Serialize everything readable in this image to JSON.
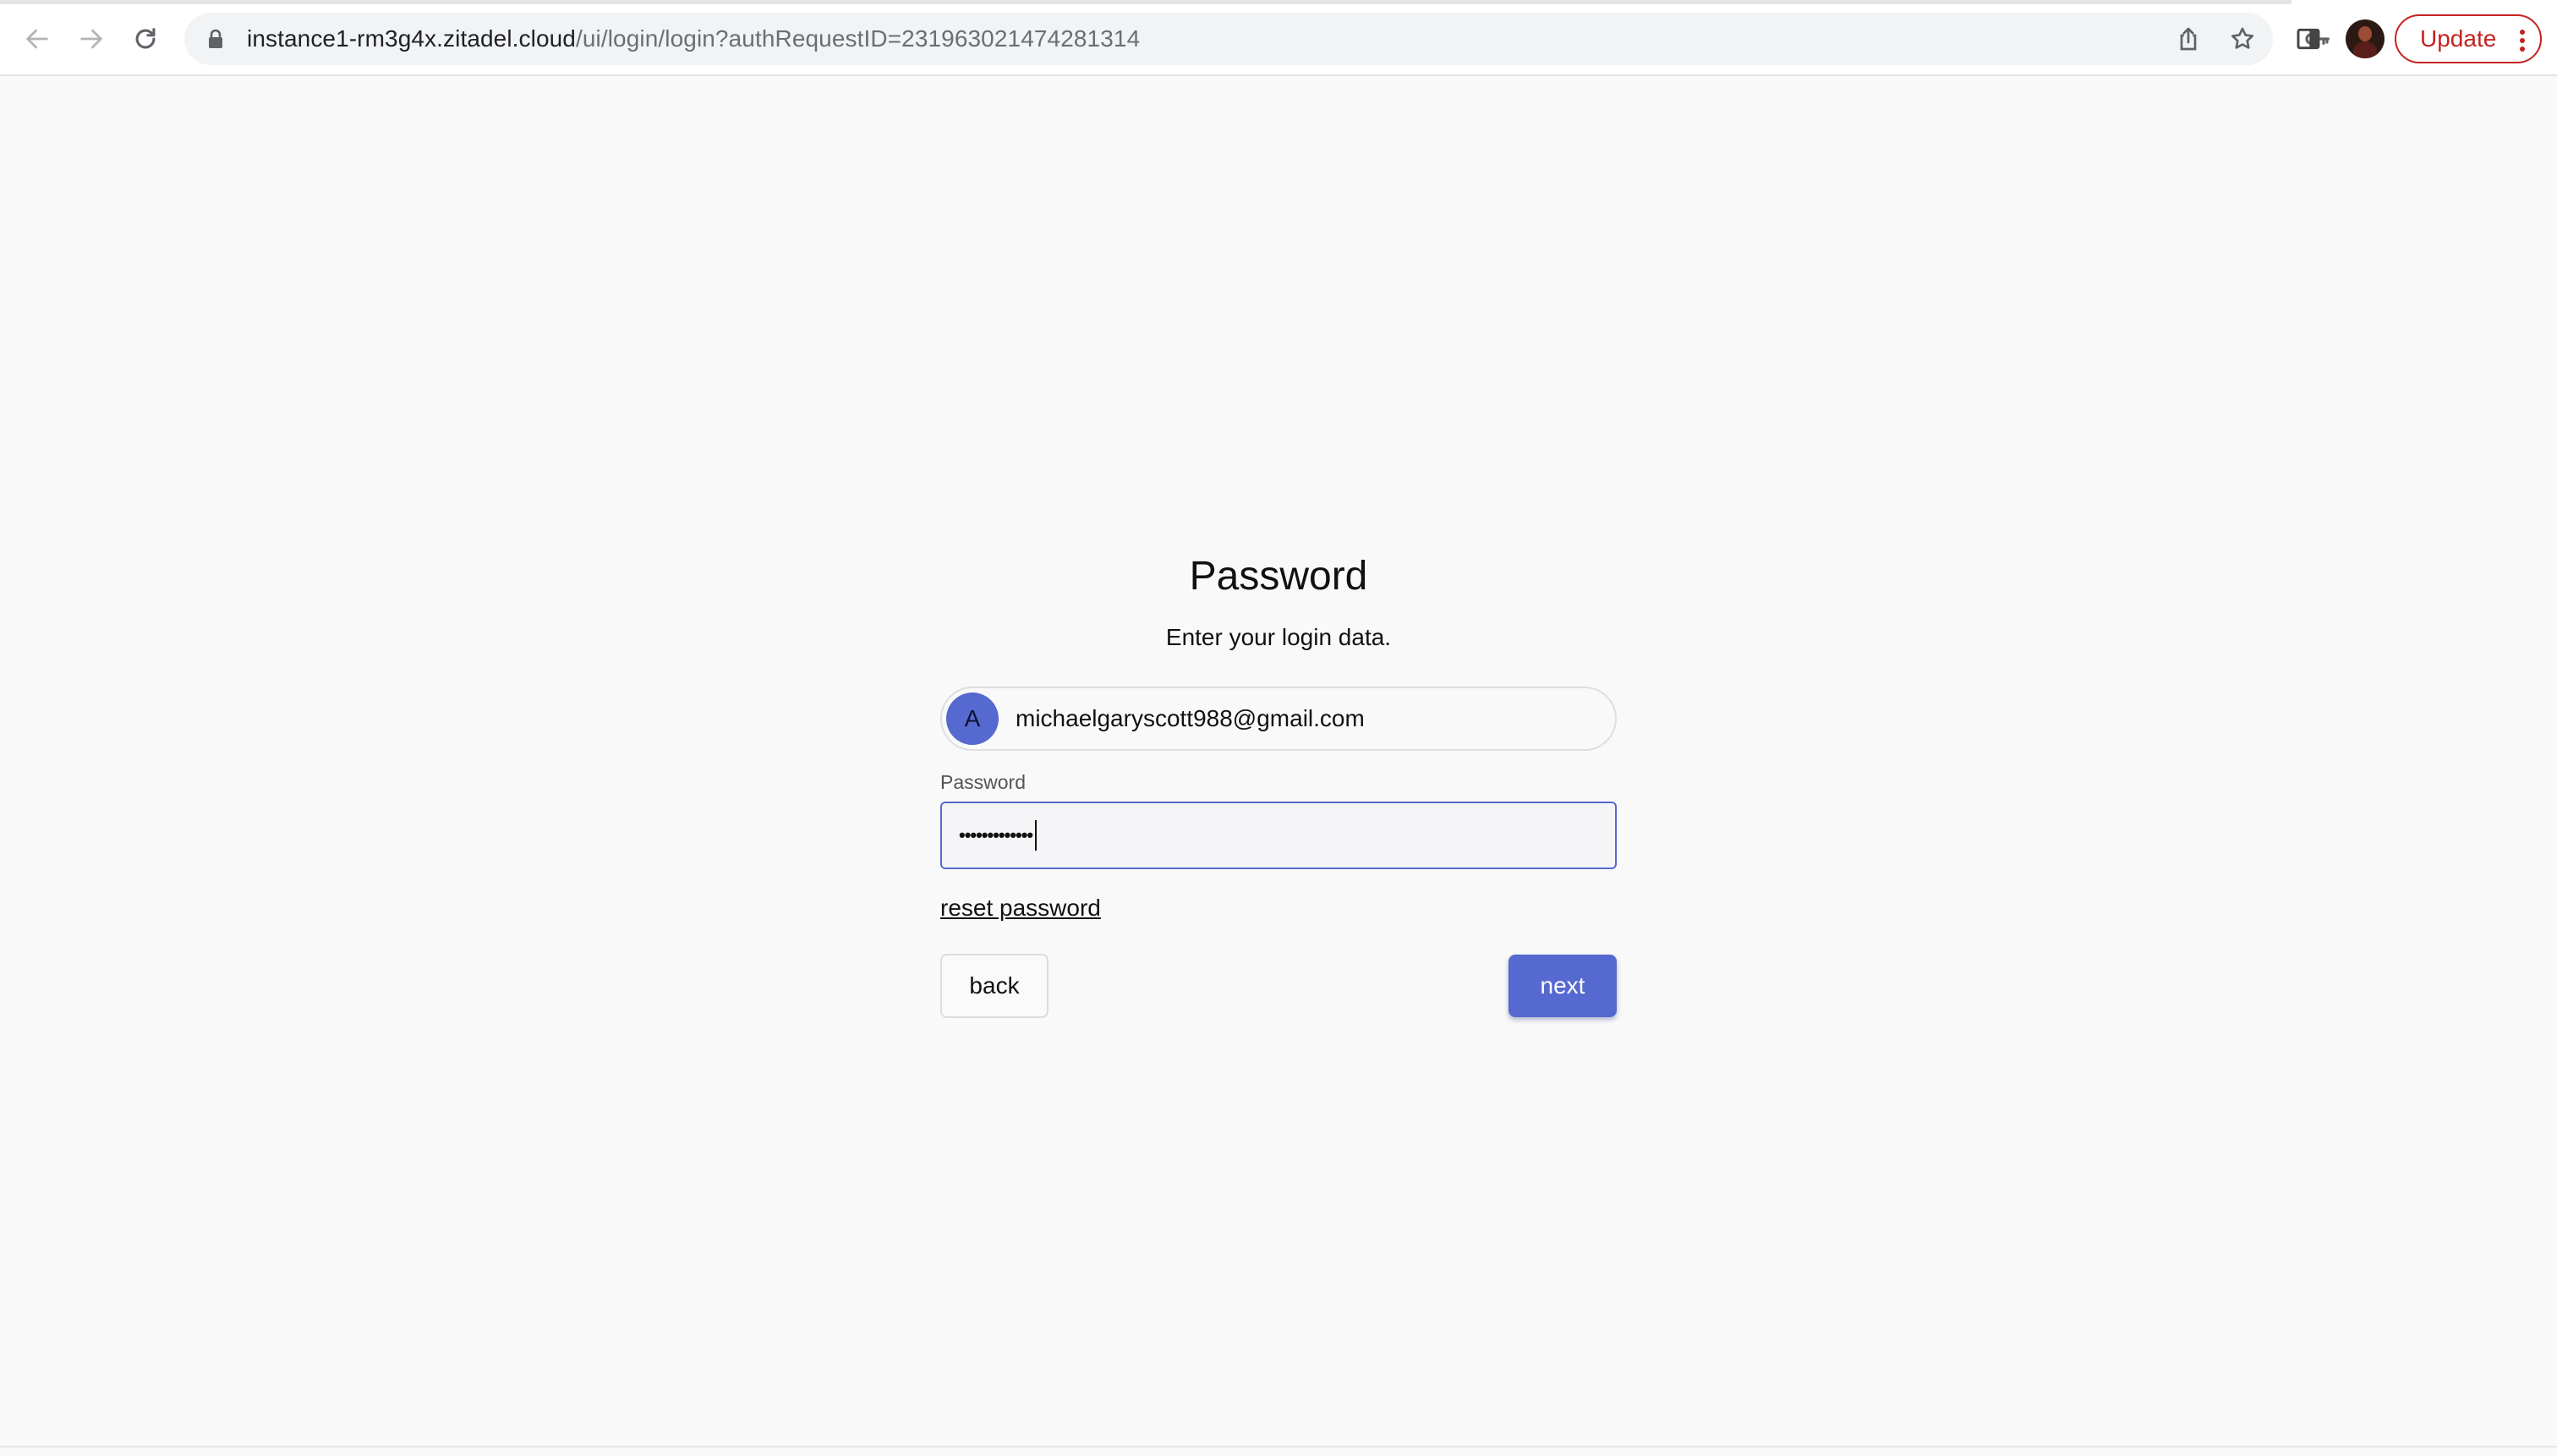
{
  "browser": {
    "url_host": "instance1-rm3g4x.zitadel.cloud",
    "url_path": "/ui/login/login?authRequestID=231963021474281314",
    "update_label": "Update",
    "icons": {
      "back": "arrow-left-icon",
      "forward": "arrow-right-icon",
      "reload": "reload-icon",
      "lock": "lock-icon",
      "key": "key-icon",
      "share": "share-icon",
      "bookmark": "star-icon",
      "side_panel": "side-panel-icon",
      "menu": "kebab-menu-icon"
    },
    "colors": {
      "update_accent": "#c5221f"
    }
  },
  "login": {
    "title": "Password",
    "subtitle": "Enter your login data.",
    "user": {
      "avatar_initial": "A",
      "login_name": "michaelgaryscott988@gmail.com"
    },
    "password_label": "Password",
    "password_value": "•••••••••••••",
    "reset_link": "reset password",
    "back_label": "back",
    "next_label": "next",
    "colors": {
      "primary": "#5669d0"
    }
  }
}
